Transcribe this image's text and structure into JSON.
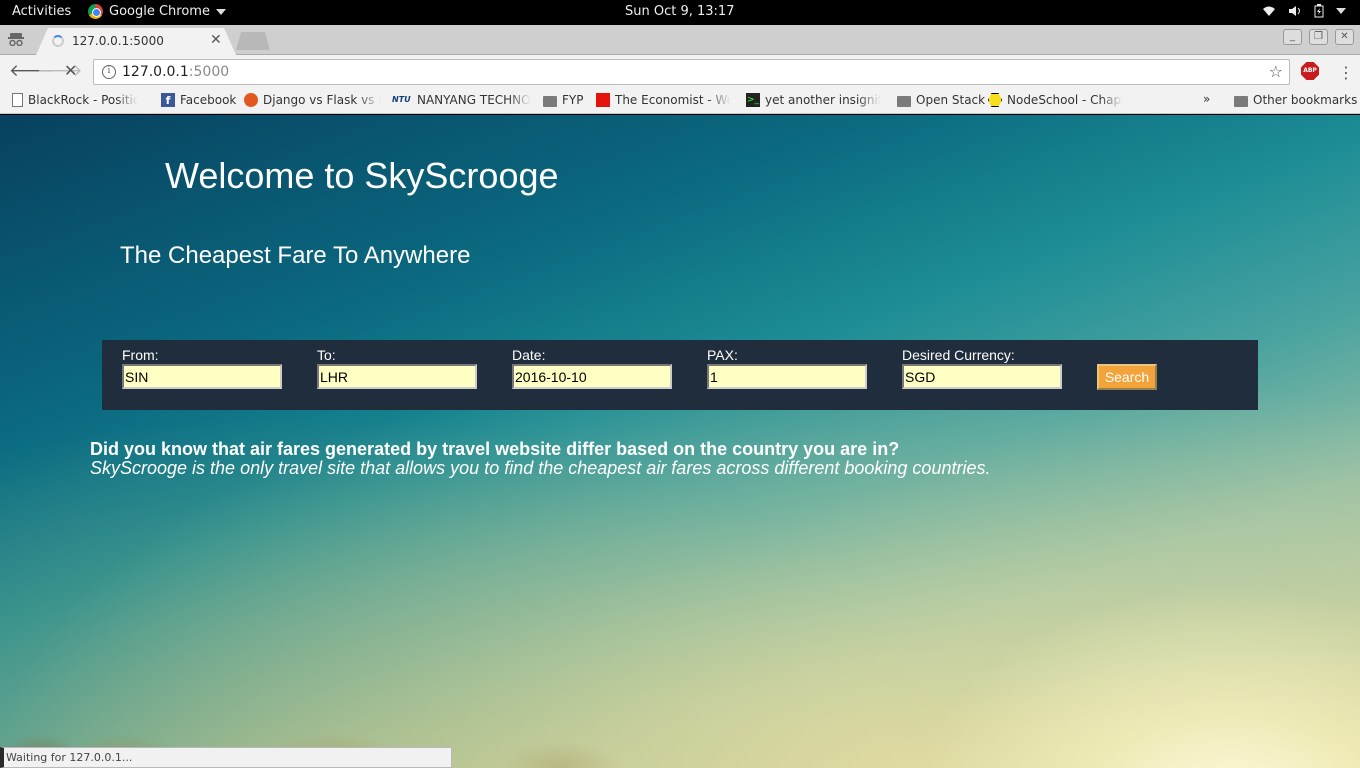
{
  "topbar": {
    "activities": "Activities",
    "app_name": "Google Chrome",
    "clock": "Sun Oct  9, 13:17"
  },
  "tab": {
    "title": "127.0.0.1:5000",
    "close": "✕"
  },
  "address_bar": {
    "host": "127.0.0.1",
    "port": ":5000"
  },
  "extension": {
    "abp": "ABP"
  },
  "bookmarks": [
    {
      "label": "BlackRock - Position F",
      "icon": "page-icon"
    },
    {
      "label": "Facebook",
      "icon": "facebook-icon"
    },
    {
      "label": "Django vs Flask vs Py",
      "icon": "django-icon"
    },
    {
      "label": "NANYANG TECHNOL",
      "icon": "ntu-icon",
      "icon_text": "NTU"
    },
    {
      "label": "FYP",
      "icon": "folder-icon"
    },
    {
      "label": "The Economist - Worl",
      "icon": "economist-icon"
    },
    {
      "label": "yet another insignifica",
      "icon": "terminal-icon"
    },
    {
      "label": "Open Stack",
      "icon": "folder-icon"
    },
    {
      "label": "NodeSchool - Chapte",
      "icon": "nodeschool-icon"
    }
  ],
  "bookmarks_overflow": "»",
  "other_bookmarks": "Other bookmarks",
  "page": {
    "heading": "Welcome to SkyScrooge",
    "subheading": "The Cheapest Fare To Anywhere",
    "form": {
      "from_label": "From:",
      "from_value": "SIN",
      "to_label": "To:",
      "to_value": "LHR",
      "date_label": "Date:",
      "date_value": "2016-10-10",
      "pax_label": "PAX:",
      "pax_value": "1",
      "currency_label": "Desired Currency:",
      "currency_value": "SGD",
      "search_label": "Search"
    },
    "info_title": "Did you know that air fares generated by travel website differ based on the country you are in?",
    "info_text": "SkyScrooge is the only travel site that allows you to find the cheapest air fares across different booking countries."
  },
  "status": "Waiting for 127.0.0.1..."
}
